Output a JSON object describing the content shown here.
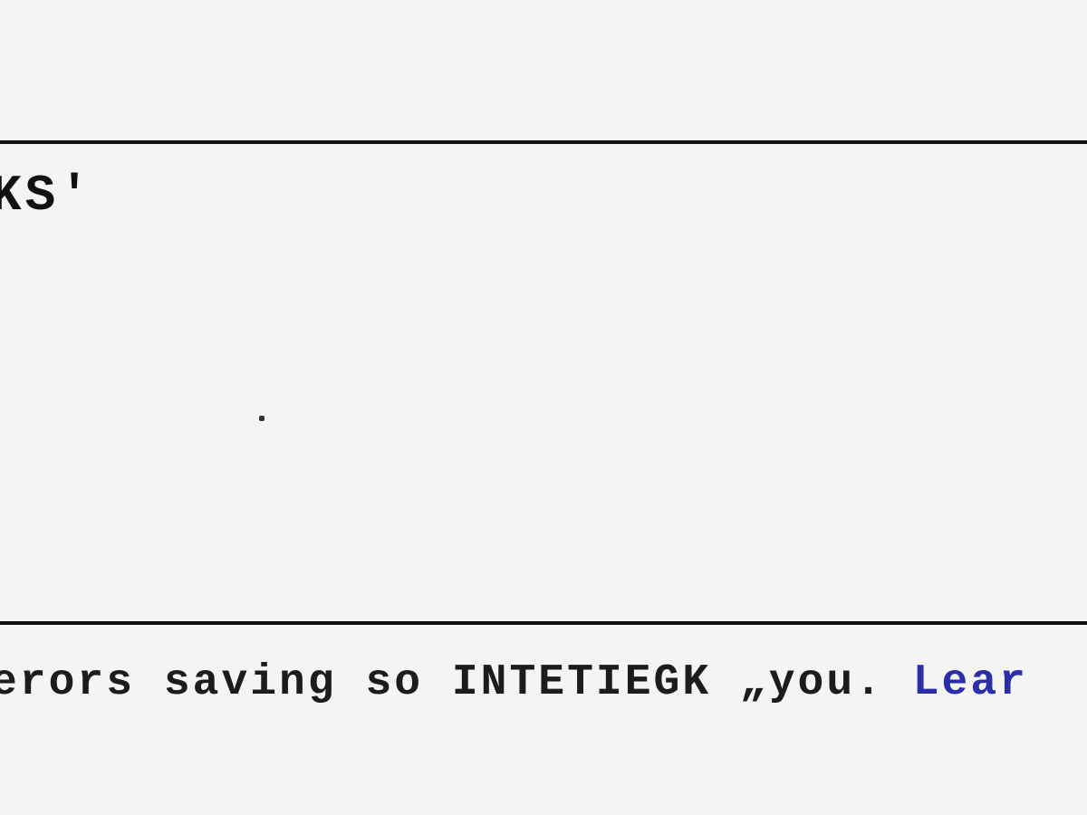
{
  "panel": {
    "heading_fragment": "KS'"
  },
  "caption": {
    "text_fragment": "erors saving so INTETIEGK „you. ",
    "link_fragment": "Lear"
  }
}
